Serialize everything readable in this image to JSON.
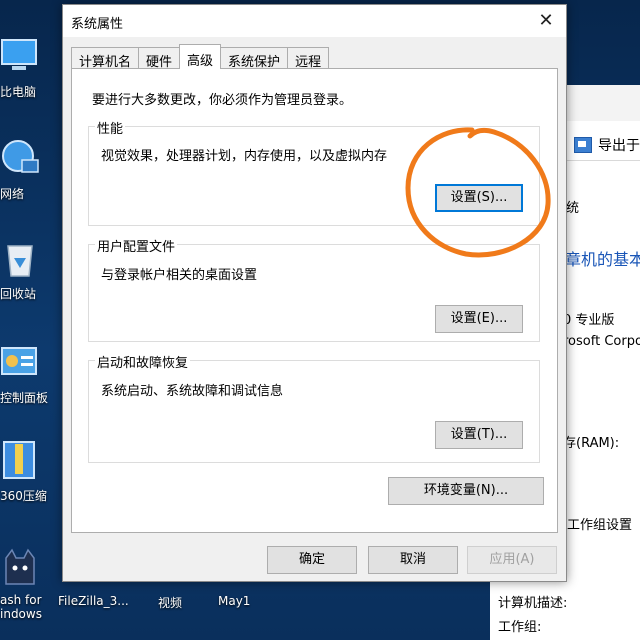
{
  "desktop": {
    "icons": [
      {
        "label": "比电脑"
      },
      {
        "label": "网络"
      },
      {
        "label": "回收站"
      },
      {
        "label": "控制面板"
      },
      {
        "label": "360压缩"
      },
      {
        "label": "ash for\nindows"
      }
    ],
    "taskbar": {
      "filezilla": "FileZilla_3...",
      "video": "视频",
      "may": "May1"
    }
  },
  "background_window": {
    "export_label": "导出于",
    "system_label": "统",
    "heading": "章机的基本",
    "edition": "0 专业版",
    "vendor": "rosoft Corpo",
    "ram": "存(RAM):",
    "workgroup_settings": "工作组设置",
    "computer_desc": "计算机描述:",
    "workgroup": "工作组:"
  },
  "dialog": {
    "title": "系统属性",
    "close_glyph": "✕",
    "tabs": [
      "计算机名",
      "硬件",
      "高级",
      "系统保护",
      "远程"
    ],
    "active_tab": 2,
    "notice": "要进行大多数更改，你必须作为管理员登录。",
    "groups": {
      "performance": {
        "title": "性能",
        "description": "视觉效果，处理器计划，内存使用，以及虚拟内存",
        "button": "设置(S)..."
      },
      "profile": {
        "title": "用户配置文件",
        "description": "与登录帐户相关的桌面设置",
        "button": "设置(E)..."
      },
      "startup": {
        "title": "启动和故障恢复",
        "description": "系统启动、系统故障和调试信息",
        "button": "设置(T)..."
      }
    },
    "env_button": "环境变量(N)...",
    "footer": {
      "ok": "确定",
      "cancel": "取消",
      "apply": "应用(A)"
    }
  },
  "colors": {
    "annotation": "#f07a1a",
    "focus": "#0078d7",
    "link_blue": "#1a56b7"
  }
}
